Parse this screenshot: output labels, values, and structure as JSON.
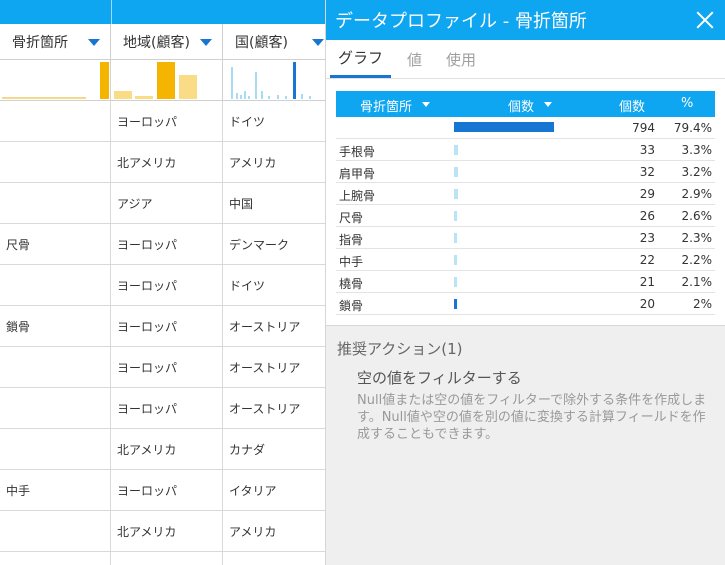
{
  "grid": {
    "headers": [
      "骨折箇所",
      "地域(顧客)",
      "国(顧客)"
    ],
    "accent_color": "#0ea5f1",
    "rows": [
      {
        "bone": "",
        "region": "ヨーロッパ",
        "country": "ドイツ"
      },
      {
        "bone": "",
        "region": "北アメリカ",
        "country": "アメリカ"
      },
      {
        "bone": "",
        "region": "アジア",
        "country": "中国"
      },
      {
        "bone": "尺骨",
        "region": "ヨーロッパ",
        "country": "デンマーク"
      },
      {
        "bone": "",
        "region": "ヨーロッパ",
        "country": "ドイツ"
      },
      {
        "bone": "鎖骨",
        "region": "ヨーロッパ",
        "country": "オーストリア"
      },
      {
        "bone": "",
        "region": "ヨーロッパ",
        "country": "オーストリア"
      },
      {
        "bone": "",
        "region": "ヨーロッパ",
        "country": "オーストリア"
      },
      {
        "bone": "",
        "region": "北アメリカ",
        "country": "カナダ"
      },
      {
        "bone": "中手",
        "region": "ヨーロッパ",
        "country": "イタリア"
      },
      {
        "bone": "",
        "region": "北アメリカ",
        "country": "アメリカ"
      },
      {
        "bone": "",
        "region": "",
        "country": ""
      }
    ]
  },
  "panel": {
    "title": "データプロファイル - 骨折箇所",
    "tabs": [
      "グラフ",
      "値",
      "使用"
    ],
    "active_tab": 0,
    "table": {
      "col_field": "骨折箇所",
      "col_bar": "個数",
      "col_count": "個数",
      "col_pct": "%",
      "rows": [
        {
          "name": "",
          "count": "794",
          "pct": "79.4%",
          "ratio": 0.794,
          "highlight": true
        },
        {
          "name": "手根骨",
          "count": "33",
          "pct": "3.3%",
          "ratio": 0.033
        },
        {
          "name": "肩甲骨",
          "count": "32",
          "pct": "3.2%",
          "ratio": 0.032
        },
        {
          "name": "上腕骨",
          "count": "29",
          "pct": "2.9%",
          "ratio": 0.029
        },
        {
          "name": "尺骨",
          "count": "26",
          "pct": "2.6%",
          "ratio": 0.026
        },
        {
          "name": "指骨",
          "count": "23",
          "pct": "2.3%",
          "ratio": 0.023
        },
        {
          "name": "中手",
          "count": "22",
          "pct": "2.2%",
          "ratio": 0.022
        },
        {
          "name": "橈骨",
          "count": "21",
          "pct": "2.1%",
          "ratio": 0.021
        },
        {
          "name": "鎖骨",
          "count": "20",
          "pct": "2%",
          "ratio": 0.02,
          "highlight": true
        }
      ]
    },
    "actions": {
      "title": "推奨アクション(1)",
      "item": "空の値をフィルターする",
      "description": "Null値または空の値をフィルターで除外する条件を作成します。Null値や空の値を別の値に変換する計算フィールドを作成することもできます。"
    }
  }
}
